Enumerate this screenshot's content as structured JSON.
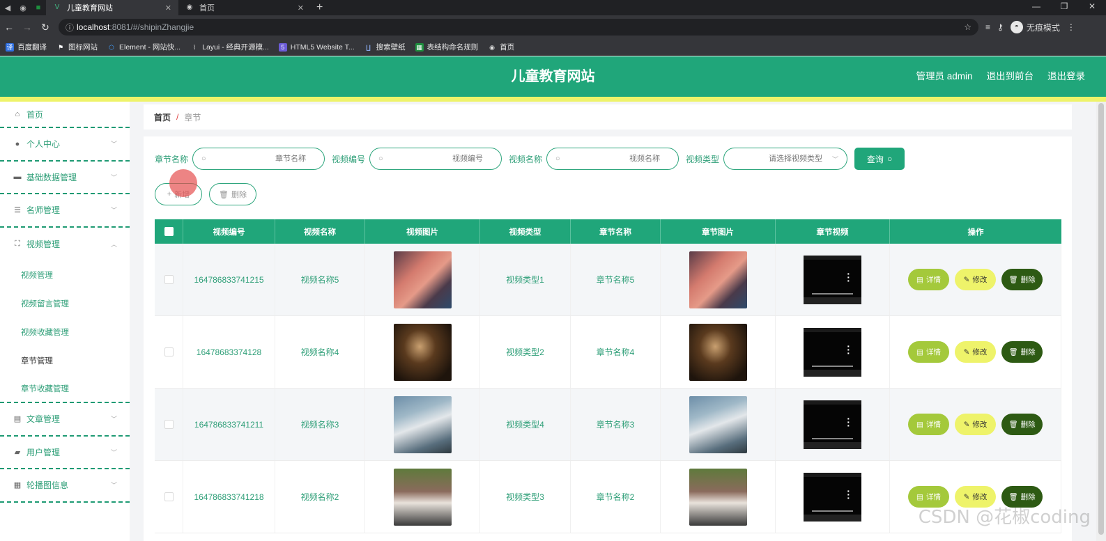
{
  "browser": {
    "tabs": [
      {
        "title": "儿童教育网站",
        "active": true
      },
      {
        "title": "首页",
        "active": false
      }
    ],
    "url_host": "localhost",
    "url_path": ":8081/#/shipinZhangjie",
    "profile_label": "无痕模式",
    "bookmarks": [
      {
        "label": "百度翻译",
        "icon": "translate-icon",
        "color": "#2f6fe0"
      },
      {
        "label": "图标网站",
        "icon": "flag-icon",
        "color": "#000000"
      },
      {
        "label": "Element - 网站快...",
        "icon": "element-icon",
        "color": "#409eff"
      },
      {
        "label": "Layui - 经典开源模...",
        "icon": "layui-icon",
        "color": "#7a7a7a"
      },
      {
        "label": "HTML5 Website T...",
        "icon": "html5-icon",
        "color": "#6b5bd6"
      },
      {
        "label": "搜索壁纸",
        "icon": "wallpaper-icon",
        "color": "#2b5fb3"
      },
      {
        "label": "表结构命名规则",
        "icon": "sheet-icon",
        "color": "#1e8e3e"
      },
      {
        "label": "首页",
        "icon": "globe-icon",
        "color": "#8a8a8a"
      }
    ]
  },
  "header": {
    "title": "儿童教育网站",
    "admin": "管理员 admin",
    "to_front": "退出到前台",
    "logout": "退出登录"
  },
  "sidebar": {
    "home": "首页",
    "items": [
      {
        "label": "个人中心",
        "icon": "user-icon"
      },
      {
        "label": "基础数据管理",
        "icon": "chat-icon"
      },
      {
        "label": "名师管理",
        "icon": "list-icon"
      },
      {
        "label": "视频管理",
        "icon": "expand-icon"
      }
    ],
    "video_sub": [
      "视频管理",
      "视频留言管理",
      "视频收藏管理",
      "章节管理",
      "章节收藏管理"
    ],
    "items_after": [
      {
        "label": "文章管理",
        "icon": "chart-icon"
      },
      {
        "label": "用户管理",
        "icon": "ticket-icon"
      },
      {
        "label": "轮播图信息",
        "icon": "grid-icon"
      }
    ]
  },
  "breadcrumb": {
    "home": "首页",
    "sep": "/",
    "current": "章节"
  },
  "search": {
    "f1_label": "章节名称",
    "f1_placeholder": "章节名称",
    "f2_label": "视频编号",
    "f2_placeholder": "视频编号",
    "f3_label": "视频名称",
    "f3_placeholder": "视频名称",
    "f4_label": "视频类型",
    "f4_placeholder": "请选择视频类型",
    "query": "查询"
  },
  "actions": {
    "add": "新增",
    "delete": "删除"
  },
  "table": {
    "headers": [
      "视频编号",
      "视频名称",
      "视频图片",
      "视频类型",
      "章节名称",
      "章节图片",
      "章节视频",
      "操作"
    ],
    "rows": [
      {
        "code": "164786833741215",
        "name": "视频名称5",
        "type": "视频类型1",
        "chapter": "章节名称5"
      },
      {
        "code": "16478683374128",
        "name": "视频名称4",
        "type": "视频类型2",
        "chapter": "章节名称4"
      },
      {
        "code": "164786833741211",
        "name": "视频名称3",
        "type": "视频类型4",
        "chapter": "章节名称3"
      },
      {
        "code": "164786833741218",
        "name": "视频名称2",
        "type": "视频类型3",
        "chapter": "章节名称2"
      }
    ],
    "btn_detail": "详情",
    "btn_edit": "修改",
    "btn_delete": "删除"
  },
  "watermark": "CSDN @花椒coding",
  "colors": {
    "primary": "#20a67a",
    "accent_yellow": "#eef36a",
    "detail": "#a4c93b",
    "delete": "#2d5a13"
  }
}
